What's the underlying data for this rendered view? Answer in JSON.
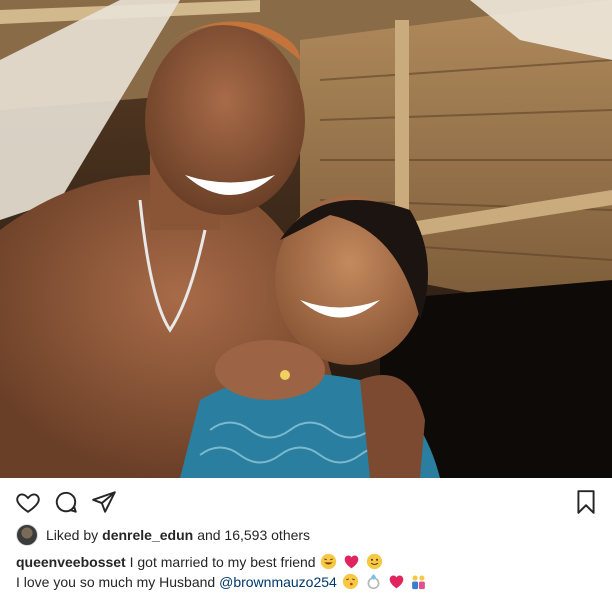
{
  "post": {
    "likes": {
      "prefix": "Liked by",
      "user": "denrele_edun",
      "suffix": "and 16,593 others"
    },
    "caption": {
      "username": "queenveebosset",
      "line1": "I got married to my best friend",
      "line2_text": "I love you so much my Husband",
      "mention": "@brownmauzo254"
    },
    "icons": {
      "like": "heart-outline-icon",
      "comment": "comment-bubble-icon",
      "share": "paper-plane-icon",
      "save": "bookmark-icon"
    },
    "colors": {
      "text": "#262626",
      "mention": "#00376b",
      "heart": "#e0245e"
    }
  }
}
